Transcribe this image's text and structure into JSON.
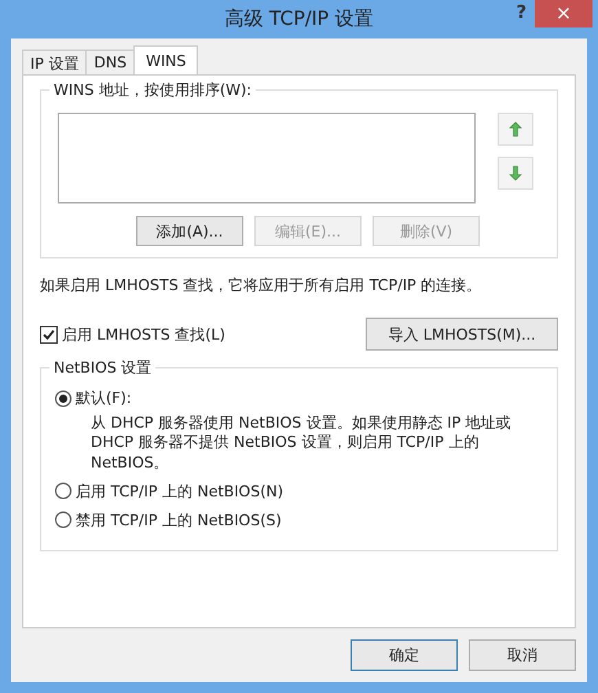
{
  "window": {
    "title": "高级 TCP/IP 设置",
    "help": "?",
    "close": "×"
  },
  "tabs": [
    {
      "label": "IP 设置",
      "selected": false
    },
    {
      "label": "DNS",
      "selected": false
    },
    {
      "label": "WINS",
      "selected": true
    }
  ],
  "wins": {
    "group_label": "WINS 地址，按使用排序(W):",
    "buttons": [
      {
        "label": "添加(A)...",
        "disabled": false
      },
      {
        "label": "编辑(E)...",
        "disabled": true
      },
      {
        "label": "删除(V)",
        "disabled": true
      }
    ]
  },
  "note": "如果启用 LMHOSTS 查找，它将应用于所有启用 TCP/IP 的连接。",
  "lmhosts": {
    "label": "启用 LMHOSTS 查找(L)",
    "checked": true,
    "import_button": "导入 LMHOSTS(M)..."
  },
  "netbios": {
    "group_label": "NetBIOS 设置",
    "options": [
      {
        "label": "默认(F):",
        "selected": true,
        "description": "从 DHCP 服务器使用 NetBIOS 设置。如果使用静态 IP 地址或 DHCP 服务器不提供 NetBIOS 设置，则启用 TCP/IP 上的 NetBIOS。"
      },
      {
        "label": "启用 TCP/IP 上的 NetBIOS(N)",
        "selected": false
      },
      {
        "label": "禁用 TCP/IP 上的 NetBIOS(S)",
        "selected": false
      }
    ]
  },
  "footer_buttons": [
    "确定",
    "取消"
  ]
}
